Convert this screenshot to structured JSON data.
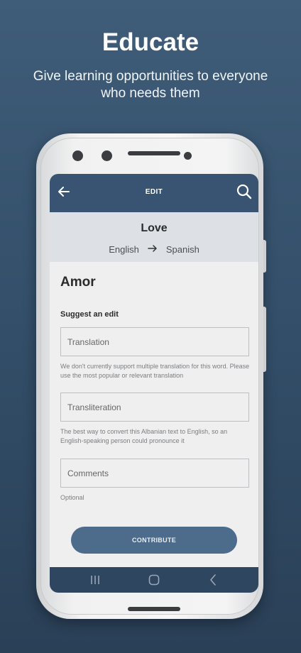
{
  "promo": {
    "title": "Educate",
    "subtitle": "Give learning opportunities to everyone who needs them"
  },
  "appbar": {
    "title": "EDIT",
    "back_icon": "arrow-left-icon",
    "search_icon": "search-icon"
  },
  "word_panel": {
    "word": "Love",
    "source_language": "English",
    "arrow_icon": "arrow-right-icon",
    "target_language": "Spanish"
  },
  "form": {
    "translated_word": "Amor",
    "section_label": "Suggest an edit",
    "translation_placeholder": "Translation",
    "translation_value": "",
    "translation_help": "We don't currently support multiple translation for this word. Please use the most popular or relevant translation",
    "transliteration_placeholder": "Transliteration",
    "transliteration_value": "",
    "transliteration_help": "The best way to convert this Albanian text to English, so an English-speaking person could pronounce it",
    "comments_placeholder": "Comments",
    "comments_value": "",
    "comments_help": "Optional",
    "contribute_label": "CONTRIBUTE"
  },
  "navbar": {
    "recents_icon": "recent-apps-icon",
    "home_icon": "home-icon",
    "back_icon": "back-chevron-icon"
  },
  "colors": {
    "background": "#3f5c78",
    "appbar": "#385472",
    "button": "#4d6c8c",
    "navbar": "#2f4660"
  }
}
